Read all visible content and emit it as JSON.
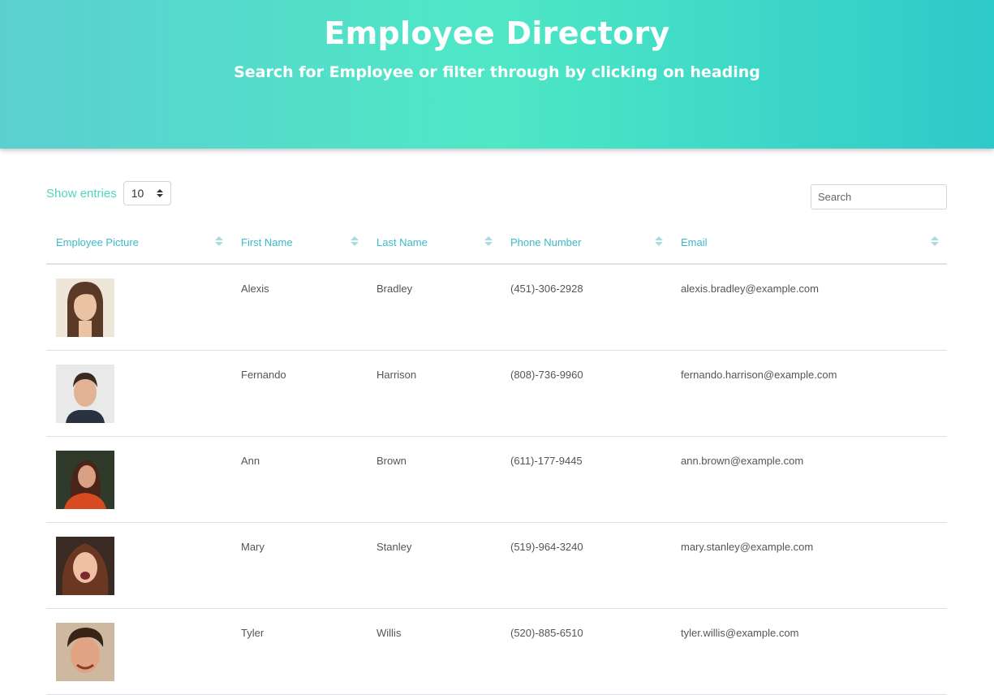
{
  "header": {
    "title": "Employee Directory",
    "subtitle": "Search for Employee or filter through by clicking on heading"
  },
  "controls": {
    "show_entries_label": "Show entries",
    "entries_value": "10",
    "search_placeholder": "Search"
  },
  "table": {
    "columns": [
      "Employee Picture",
      "First Name",
      "Last Name",
      "Phone Number",
      "Email"
    ],
    "rows": [
      {
        "first": "Alexis",
        "last": "Bradley",
        "phone": "(451)-306-2928",
        "email": "alexis.bradley@example.com"
      },
      {
        "first": "Fernando",
        "last": "Harrison",
        "phone": "(808)-736-9960",
        "email": "fernando.harrison@example.com"
      },
      {
        "first": "Ann",
        "last": "Brown",
        "phone": "(611)-177-9445",
        "email": "ann.brown@example.com"
      },
      {
        "first": "Mary",
        "last": "Stanley",
        "phone": "(519)-964-3240",
        "email": "mary.stanley@example.com"
      },
      {
        "first": "Tyler",
        "last": "Willis",
        "phone": "(520)-885-6510",
        "email": "tyler.willis@example.com"
      }
    ]
  },
  "colors": {
    "header_gradient_start": "#5bcfd0",
    "header_gradient_mid": "#4ee8c6",
    "header_gradient_end": "#2ec9c9",
    "heading_text": "#3bb9c9",
    "show_entries_text": "#4ed6c0"
  }
}
